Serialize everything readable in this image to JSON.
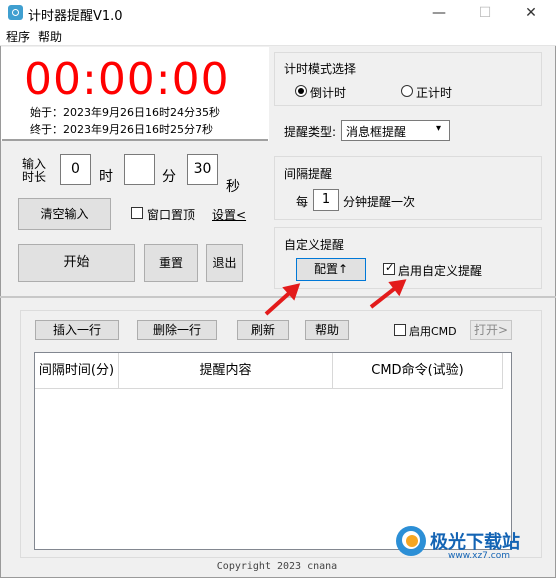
{
  "window": {
    "title": "计时器提醒V1.0",
    "minimize": "—",
    "maximize": "☐",
    "close": "✕"
  },
  "menu": [
    "程序",
    "帮助"
  ],
  "timer": {
    "display": "00:00:00",
    "start_time": "始于：2023年9月26日16时24分35秒",
    "end_time": "终于：2023年9月26日16时25分7秒"
  },
  "input": {
    "label_line1": "输入",
    "label_line2": "时长",
    "hours": "0",
    "hours_unit": "时",
    "minutes": "",
    "minutes_unit": "分",
    "seconds": "30",
    "seconds_unit": "秒"
  },
  "buttons": {
    "clear": "清空输入",
    "topmost": "窗口置顶",
    "settings": "设置<",
    "start": "开始",
    "reset": "重置",
    "exit": "退出"
  },
  "mode": {
    "title": "计时模式选择",
    "countdown": "倒计时",
    "countup": "正计时",
    "selected": "countdown"
  },
  "reminder_type": {
    "label": "提醒类型:",
    "value": "消息框提醒"
  },
  "interval": {
    "title": "间隔提醒",
    "prefix": "每",
    "value": "1",
    "suffix": "分钟提醒一次"
  },
  "custom": {
    "title": "自定义提醒",
    "config_button": "配置↑",
    "enable_label": "启用自定义提醒",
    "enabled": true
  },
  "toolbar": {
    "insert": "插入一行",
    "delete": "删除一行",
    "refresh": "刷新",
    "help": "帮助",
    "enable_cmd": "启用CMD",
    "open": "打开>"
  },
  "table": {
    "columns": [
      "间隔时间(分)",
      "提醒内容",
      "CMD命令(试验)"
    ],
    "rows": []
  },
  "footer": "Copyright 2023 cnana",
  "watermark": {
    "text": "极光下载站",
    "url": "www.xz7.com"
  }
}
